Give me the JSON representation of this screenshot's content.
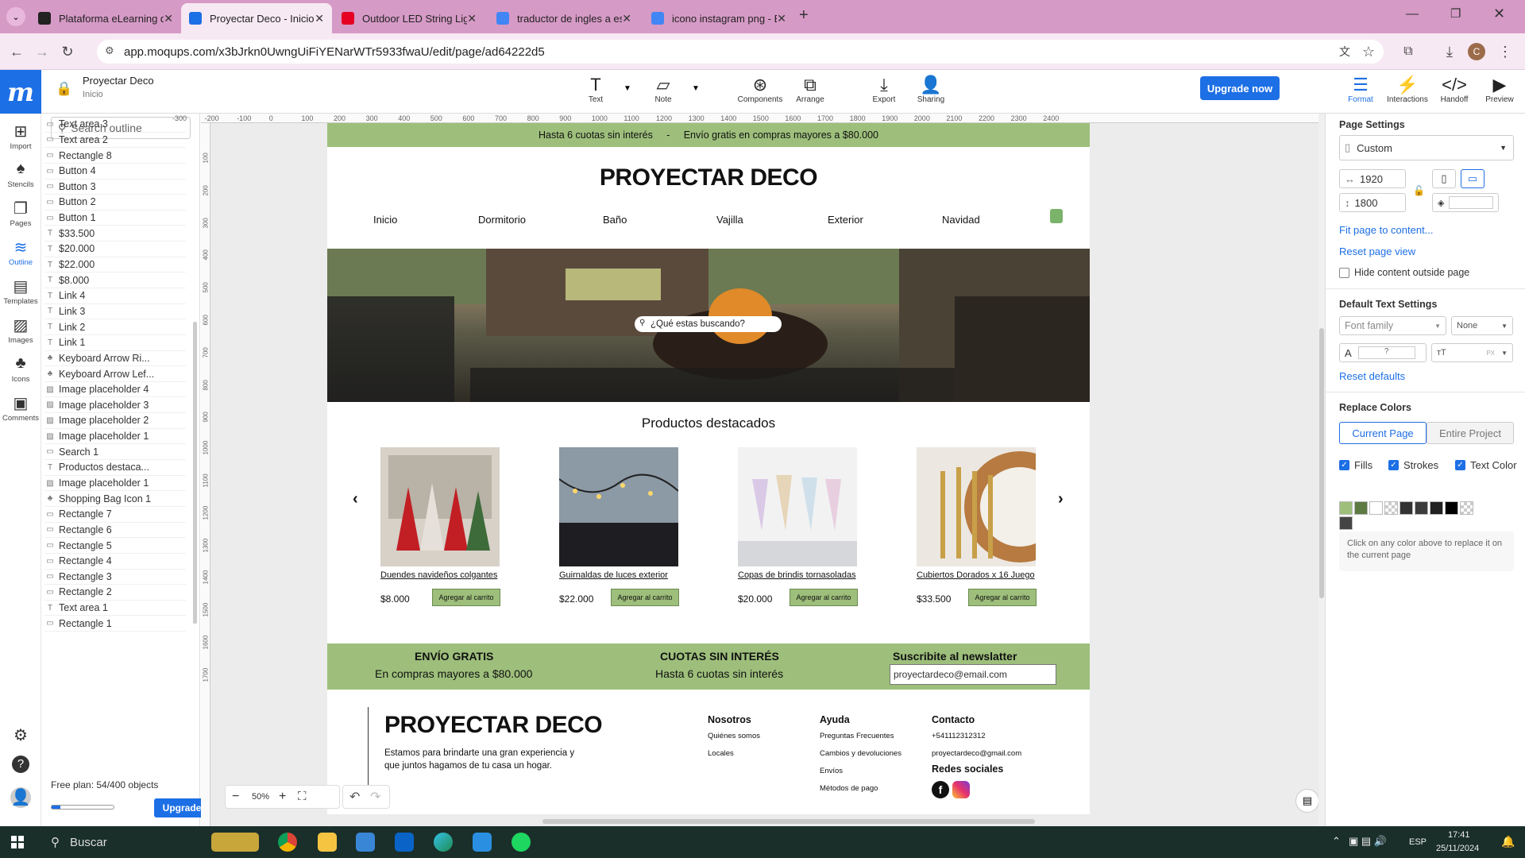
{
  "browser": {
    "tabs": [
      {
        "title": "Plataforma eLearning de Coder",
        "icon": "coderhouse-icon",
        "color": "#222"
      },
      {
        "title": "Proyectar Deco - Inicio - Moqup",
        "icon": "moqups-icon",
        "color": "#1d6fe5",
        "active": true
      },
      {
        "title": "Outdoor LED String Lights - Bla",
        "icon": "pinterest-icon",
        "color": "#e60023"
      },
      {
        "title": "traductor de ingles a español -",
        "icon": "google-icon",
        "color": "#4285f4"
      },
      {
        "title": "icono instagram png - Buscar c",
        "icon": "google-icon",
        "color": "#4285f4"
      }
    ],
    "url": "app.moqups.com/x3bJrkn0UwngUiFiYENarWTr5933fwaU/edit/page/ad64222d5",
    "profile_letter": "C"
  },
  "app": {
    "project_name": "Proyectar Deco",
    "page_name": "Inicio",
    "tools": [
      "Text",
      "Note",
      "Components",
      "Arrange",
      "Export",
      "Sharing"
    ],
    "upgrade_now": "Upgrade now",
    "right_tools": [
      "Format",
      "Interactions",
      "Handoff",
      "Preview"
    ]
  },
  "leftrail": [
    "Import",
    "Stencils",
    "Pages",
    "Outline",
    "Templates",
    "Images",
    "Icons",
    "Comments"
  ],
  "outline": {
    "search_placeholder": "Search outline",
    "items": [
      {
        "label": "Text area 3",
        "icon": "▭"
      },
      {
        "label": "Text area 2",
        "icon": "▭"
      },
      {
        "label": "Rectangle 8",
        "icon": "▭"
      },
      {
        "label": "Button 4",
        "icon": "▭"
      },
      {
        "label": "Button 3",
        "icon": "▭"
      },
      {
        "label": "Button 2",
        "icon": "▭"
      },
      {
        "label": "Button 1",
        "icon": "▭"
      },
      {
        "label": "$33.500",
        "icon": "T"
      },
      {
        "label": "$20.000",
        "icon": "T"
      },
      {
        "label": "$22.000",
        "icon": "T"
      },
      {
        "label": "$8.000",
        "icon": "T"
      },
      {
        "label": "Link 4",
        "icon": "T"
      },
      {
        "label": "Link 3",
        "icon": "T"
      },
      {
        "label": "Link 2",
        "icon": "T"
      },
      {
        "label": "Link 1",
        "icon": "T"
      },
      {
        "label": "Keyboard Arrow Ri...",
        "icon": "♣"
      },
      {
        "label": "Keyboard Arrow Lef...",
        "icon": "♣"
      },
      {
        "label": "Image placeholder 4",
        "icon": "▨"
      },
      {
        "label": "Image placeholder 3",
        "icon": "▨"
      },
      {
        "label": "Image placeholder 2",
        "icon": "▨"
      },
      {
        "label": "Image placeholder 1",
        "icon": "▨"
      },
      {
        "label": "Search 1",
        "icon": "▭"
      },
      {
        "label": "Productos destaca...",
        "icon": "T"
      },
      {
        "label": "Image placeholder 1",
        "icon": "▨"
      },
      {
        "label": "Shopping Bag Icon 1",
        "icon": "♣"
      },
      {
        "label": "Rectangle 7",
        "icon": "▭"
      },
      {
        "label": "Rectangle 6",
        "icon": "▭"
      },
      {
        "label": "Rectangle 5",
        "icon": "▭"
      },
      {
        "label": "Rectangle 4",
        "icon": "▭"
      },
      {
        "label": "Rectangle 3",
        "icon": "▭"
      },
      {
        "label": "Rectangle 2",
        "icon": "▭"
      },
      {
        "label": "Text area 1",
        "icon": "T"
      },
      {
        "label": "Rectangle 1",
        "icon": "▭"
      }
    ],
    "free_plan": "Free plan: 54/400 objects",
    "progress": 0.135,
    "upgrade": "Upgrade"
  },
  "ruler": {
    "h": [
      "-300",
      "-200",
      "-100",
      "0",
      "100",
      "200",
      "300",
      "400",
      "500",
      "600",
      "700",
      "800",
      "900",
      "1000",
      "1100",
      "1200",
      "1300",
      "1400",
      "1500",
      "1600",
      "1700",
      "1800",
      "1900",
      "2000",
      "2100",
      "2200",
      "2300",
      "2400"
    ],
    "v": [
      "100",
      "200",
      "300",
      "400",
      "500",
      "600",
      "700",
      "800",
      "900",
      "1000",
      "1100",
      "1200",
      "1300",
      "1400",
      "1500",
      "1600",
      "1700"
    ]
  },
  "site": {
    "promo": "Hasta 6 cuotas sin interés     -     Envío gratis en compras mayores a $80.000",
    "brand": "PROYECTAR DECO",
    "nav": [
      "Inicio",
      "Dormitorio",
      "Baño",
      "Vajilla",
      "Exterior",
      "Navidad"
    ],
    "search_placeholder": "¿Qué estas buscando?",
    "featured_title": "Productos destacados",
    "products": [
      {
        "name": "Duendes navideños colgantes",
        "price": "$8.000",
        "button": "Agregar al carrito"
      },
      {
        "name": "Guirnaldas de luces exterior",
        "price": "$22.000",
        "button": "Agregar al carrito"
      },
      {
        "name": "Copas de brindis tornasoladas",
        "price": "$20.000",
        "button": "Agregar al carrito"
      },
      {
        "name": "Cubiertos Dorados x 16 Juego",
        "price": "$33.500",
        "button": "Agregar al carrito"
      }
    ],
    "info": [
      {
        "title": "ENVÍO GRATIS",
        "text": "En compras mayores a $80.000"
      },
      {
        "title": "CUOTAS SIN INTERÉS",
        "text": "Hasta 6 cuotas sin interés"
      }
    ],
    "newsletter_title": "Suscribite al newslatter",
    "newsletter_placeholder": "proyectardeco@email.com",
    "footer": {
      "brand": "PROYECTAR DECO",
      "desc": "Estamos para brindarte una gran experiencia y que juntos hagamos de tu casa un hogar.",
      "cols": [
        {
          "title": "Nosotros",
          "links": [
            "Quiénes somos",
            "Locales"
          ]
        },
        {
          "title": "Ayuda",
          "links": [
            "Preguntas Frecuentes",
            "Cambios y devoluciones",
            "Envíos",
            "Métodos de pago"
          ]
        },
        {
          "title": "Contacto",
          "links": [
            "+541112312312",
            "proyectardeco@gmail.com"
          ]
        }
      ],
      "social_title": "Redes sociales"
    }
  },
  "zoom": "50%",
  "rightpanel": {
    "page_settings": "Page Settings",
    "preset": "Custom",
    "width": "1920",
    "height": "1800",
    "fit": "Fit page to content...",
    "reset_view": "Reset page view",
    "hide_outside": "Hide content outside page",
    "default_text": "Default Text Settings",
    "font_family": "Font family",
    "none": "None",
    "font_size_placeholder": "?",
    "px": "PX",
    "reset_defaults": "Reset defaults",
    "replace_colors": "Replace Colors",
    "current_page": "Current Page",
    "entire_project": "Entire Project",
    "fills": "Fills",
    "strokes": "Strokes",
    "text_color": "Text Color",
    "swatches": [
      "#9dbf7b",
      "#5c7a42",
      "#ffffff",
      "checker",
      "#333333",
      "#3c3c3c",
      "#222222",
      "#000000",
      "checker",
      "#444444"
    ],
    "hint": "Click on any color above to replace it on the current page"
  },
  "taskbar": {
    "search": "Buscar",
    "lang": "ESP",
    "time": "17:41",
    "date": "25/11/2024"
  }
}
